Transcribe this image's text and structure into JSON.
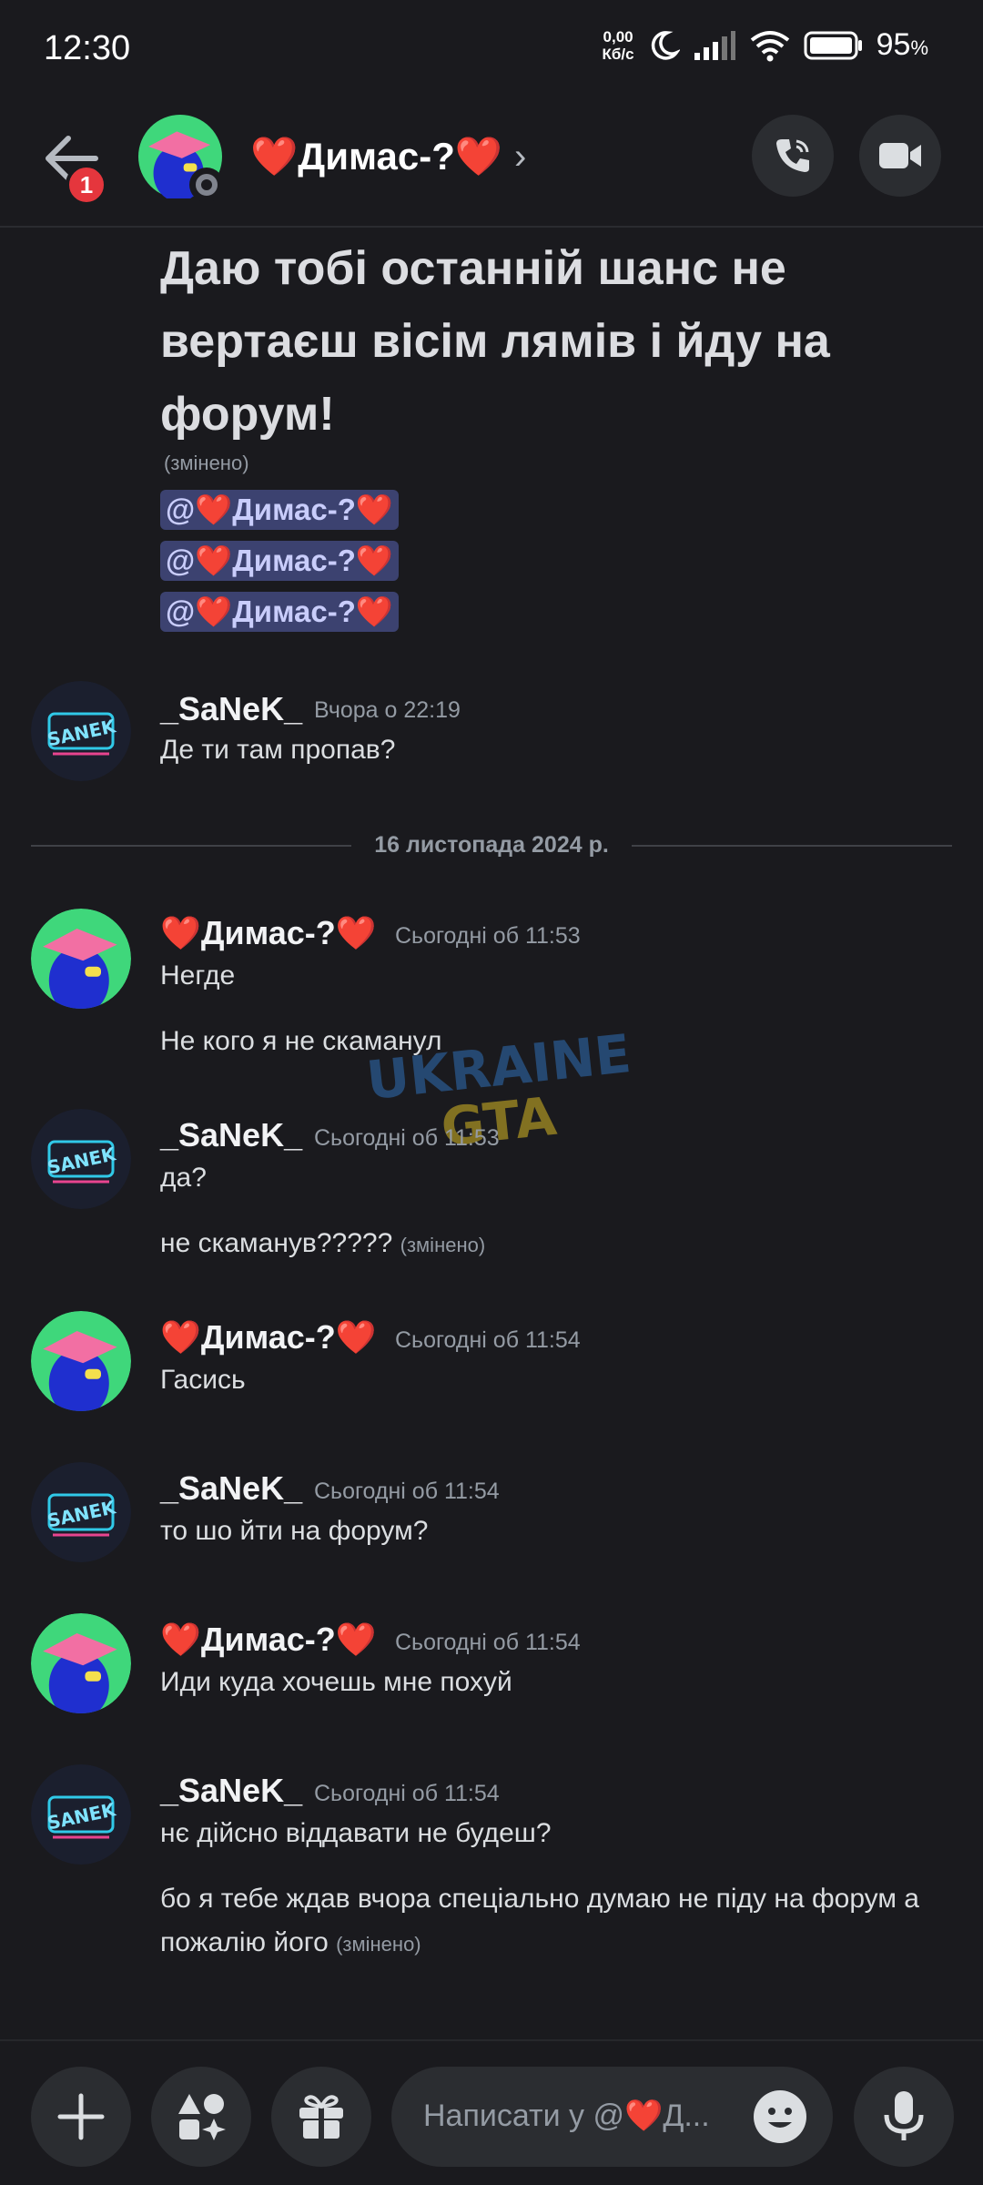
{
  "status": {
    "time": "12:30",
    "net_speed_top": "0,00",
    "net_speed_bottom": "Кб/с",
    "battery": "95",
    "battery_unit": "%"
  },
  "header": {
    "title": "❤️Димас-?❤️",
    "back_badge": "1"
  },
  "messages": {
    "big_text": "Даю тобі останній шанс не вертаєш вісім лямів і йду на форум!",
    "big_edited": "(змінено)",
    "mention": "@❤️Димас-?❤️",
    "m1_user": "_SaNeK_",
    "m1_time": "Вчора о 22:19",
    "m1_text": "Де ти там пропав?",
    "date_divider": "16 листопада 2024 р.",
    "m2_user": "❤️Димас-?❤️",
    "m2_time": "Сьогодні об 11:53",
    "m2_text1": "Негде",
    "m2_text2": "Не кого я не скаманул",
    "m3_user": "_SaNeK_",
    "m3_time": "Сьогодні об 11:53",
    "m3_text1": "да?",
    "m3_text2": "не скаманув?????",
    "m3_edited": "(змінено)",
    "m4_user": "❤️Димас-?❤️",
    "m4_time": "Сьогодні об 11:54",
    "m4_text": "Гасись",
    "m5_user": "_SaNeK_",
    "m5_time": "Сьогодні об 11:54",
    "m5_text": "то шо йти на форум?",
    "m6_user": "❤️Димас-?❤️",
    "m6_time": "Сьогодні об 11:54",
    "m6_text": "Иди куда хочешь мне похуй",
    "m7_user": "_SaNeK_",
    "m7_time": "Сьогодні об 11:54",
    "m7_text1": "нє дійсно віддавати не будеш?",
    "m7_text2": "бо я тебе ждав вчора спеціально думаю не піду на форум а пожалію його",
    "m7_edited": "(змінено)"
  },
  "watermark": {
    "line1": "UKRAINE",
    "line2": "GTA"
  },
  "composer": {
    "placeholder": "Написати у @❤️Д..."
  },
  "colors": {
    "background": "#1a1a1e",
    "mention_bg": "#3c4270",
    "badge": "#e5363d",
    "dimas_avatar_bg": "#3fd77b"
  }
}
